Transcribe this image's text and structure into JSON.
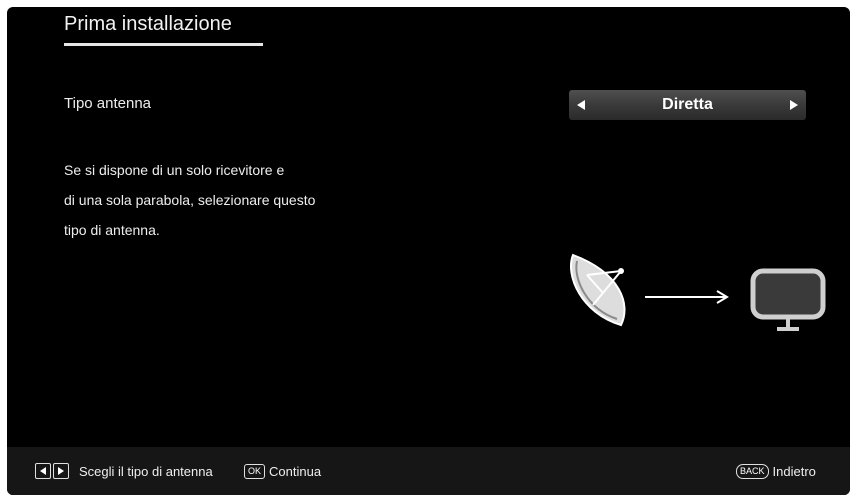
{
  "header": {
    "title": "Prima installazione"
  },
  "antenna": {
    "label": "Tipo antenna",
    "selected_value": "Diretta"
  },
  "description": {
    "lines": [
      "Se si dispone di un solo ricevitore e",
      "di una sola parabola, selezionare questo",
      "tipo di antenna."
    ]
  },
  "diagram": {
    "icons": [
      "satellite-dish-icon",
      "arrow-right-icon",
      "tv-icon"
    ]
  },
  "footer": {
    "choose_label": "Scegli il tipo di antenna",
    "ok_key": "OK",
    "continue_label": "Continua",
    "back_key": "BACK",
    "back_label": "Indietro"
  },
  "colors": {
    "background": "#000000",
    "text": "#eeeeee",
    "selector": "#3a3a3a",
    "footer": "#161616"
  }
}
